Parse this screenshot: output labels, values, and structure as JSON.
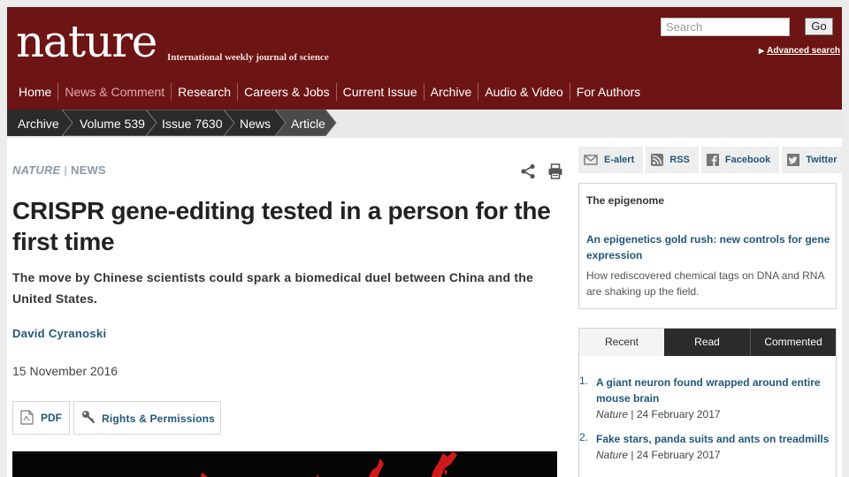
{
  "header": {
    "logo": "nature",
    "tagline": "International weekly journal of science",
    "search_placeholder": "Search",
    "go_label": "Go",
    "advanced_search": "Advanced search"
  },
  "nav": [
    {
      "label": "Home"
    },
    {
      "label": "News & Comment"
    },
    {
      "label": "Research"
    },
    {
      "label": "Careers & Jobs"
    },
    {
      "label": "Current Issue"
    },
    {
      "label": "Archive"
    },
    {
      "label": "Audio & Video"
    },
    {
      "label": "For Authors"
    }
  ],
  "breadcrumb": [
    {
      "label": "Archive"
    },
    {
      "label": "Volume 539"
    },
    {
      "label": "Issue 7630"
    },
    {
      "label": "News"
    },
    {
      "label": "Article"
    }
  ],
  "article": {
    "journal": "NATURE",
    "section": "NEWS",
    "headline": "CRISPR gene-editing tested in a person for the first time",
    "standfirst": "The move by Chinese scientists could spark a biomedical duel between China and the United States.",
    "author": "David Cyranoski",
    "date": "15 November 2016",
    "pdf_label": "PDF",
    "rights_label": "Rights & Permissions"
  },
  "sidebar": {
    "share": [
      {
        "label": "E-alert",
        "icon": "email-icon"
      },
      {
        "label": "RSS",
        "icon": "rss-icon"
      },
      {
        "label": "Facebook",
        "icon": "facebook-icon"
      },
      {
        "label": "Twitter",
        "icon": "twitter-icon"
      }
    ],
    "promo": {
      "title": "The epigenome",
      "link": "An epigenetics gold rush: new controls for gene expression",
      "description": "How rediscovered chemical tags on DNA and RNA are shaking up the field."
    },
    "tabs": [
      {
        "label": "Recent"
      },
      {
        "label": "Read"
      },
      {
        "label": "Commented"
      }
    ],
    "recent": [
      {
        "num": "1.",
        "title": "A giant neuron found wrapped around entire mouse brain",
        "journal": "Nature",
        "date": "| 24 February 2017"
      },
      {
        "num": "2.",
        "title": "Fake stars, panda suits and ants on treadmills",
        "journal": "Nature",
        "date": "| 24 February 2017"
      }
    ]
  },
  "colors": {
    "masthead": "#6d1414",
    "link": "#20587a",
    "breadcrumb": "#2b2b2b"
  }
}
